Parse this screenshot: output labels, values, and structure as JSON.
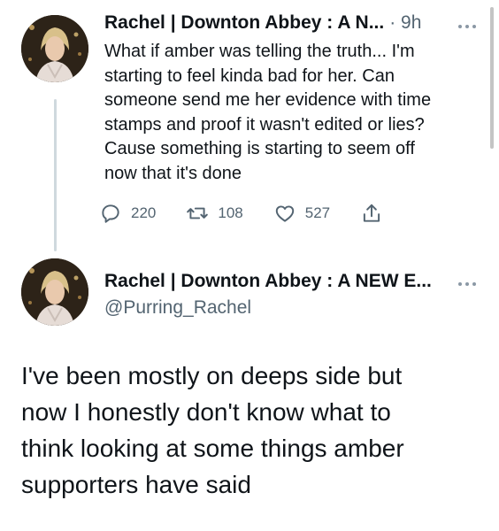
{
  "tweet1": {
    "display_name": "Rachel | Downton Abbey : A N...",
    "time_meta": "· 9h",
    "lines": [
      "What if amber was telling the truth... I'm",
      "starting to feel kinda bad for her. Can",
      "someone send me her evidence with time",
      "stamps and proof it wasn't edited or lies?",
      "Cause something is starting to seem off",
      "now that it's done"
    ],
    "reply_count": "220",
    "retweet_count": "108",
    "like_count": "527",
    "icons": [
      "reply-icon",
      "retweet-icon",
      "like-icon",
      "share-icon",
      "more-icon"
    ]
  },
  "tweet2": {
    "display_name": "Rachel | Downton Abbey : A NEW E...",
    "handle": "@Purring_Rachel",
    "lines": [
      "I've been mostly on deeps side but",
      "now I honestly don't know what to",
      "think looking at some things amber",
      "supporters have said"
    ],
    "icons": [
      "more-icon"
    ]
  },
  "colors": {
    "text": "#0f1419",
    "secondary": "#536471",
    "thread_line": "#cfd9de"
  }
}
